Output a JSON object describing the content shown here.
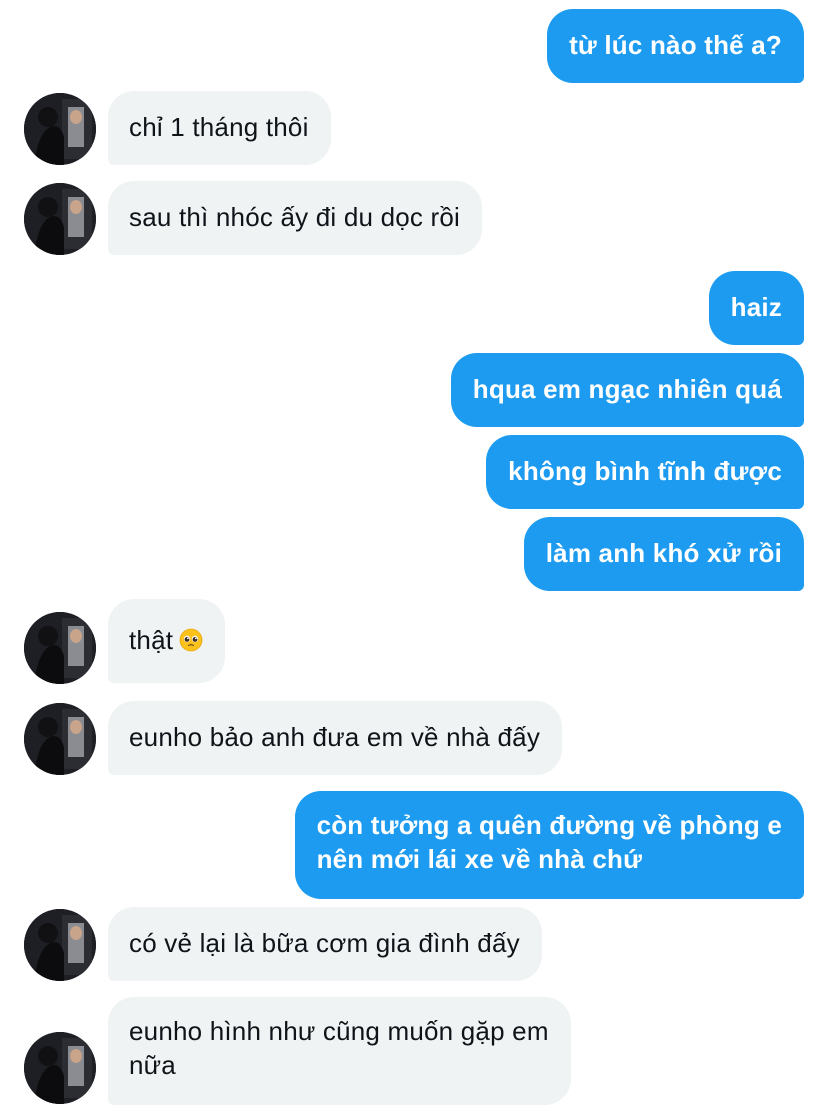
{
  "thread": {
    "messages": [
      {
        "id": "m1",
        "side": "out",
        "text": "từ lúc nào thế a?"
      },
      {
        "id": "m2",
        "side": "in",
        "text": "chỉ 1 tháng thôi"
      },
      {
        "id": "m3",
        "side": "in",
        "text": "sau thì nhóc ấy đi du dọc rồi"
      },
      {
        "id": "m4",
        "side": "out",
        "text": "haiz"
      },
      {
        "id": "m5",
        "side": "out",
        "text": "hqua em ngạc nhiên quá"
      },
      {
        "id": "m6",
        "side": "out",
        "text": "không bình tĩnh được"
      },
      {
        "id": "m7",
        "side": "out",
        "text": "làm anh khó xử rồi"
      },
      {
        "id": "m8",
        "side": "in",
        "text": "thật",
        "emoji": "pleading-face"
      },
      {
        "id": "m9",
        "side": "in",
        "text": "eunho bảo anh đưa em về nhà đấy"
      },
      {
        "id": "m10",
        "side": "out",
        "lines": [
          "còn tưởng a quên đường về phòng e",
          "nên mới lái xe về nhà chứ"
        ]
      },
      {
        "id": "m11",
        "side": "in",
        "text": "có vẻ lại là bữa cơm gia đình đấy"
      },
      {
        "id": "m12",
        "side": "in",
        "lines": [
          "eunho hình như cũng muốn gặp em",
          "nữa"
        ]
      }
    ]
  },
  "colors": {
    "outgoing_bubble": "#1d9bf0",
    "incoming_bubble": "#eff3f4",
    "outgoing_text": "#ffffff",
    "incoming_text": "#0f1419"
  },
  "avatar": {
    "icon": "user-avatar-photo"
  }
}
